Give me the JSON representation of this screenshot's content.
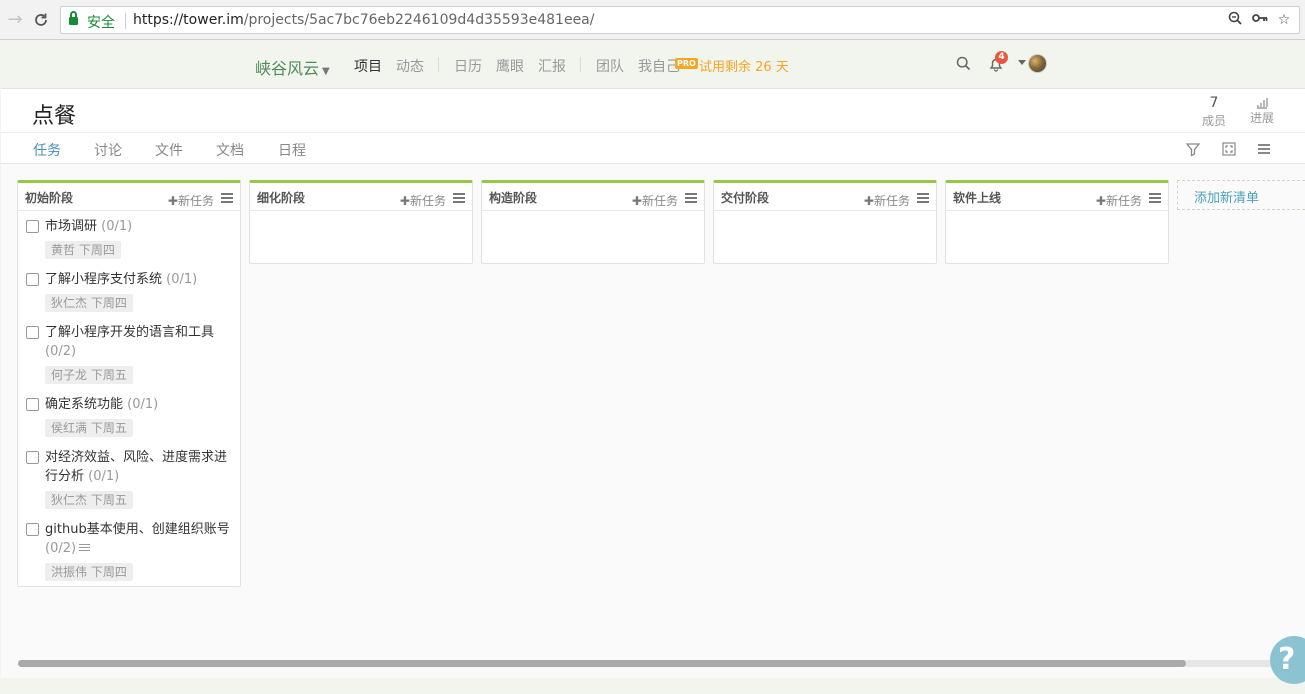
{
  "browser": {
    "secure_label": "安全",
    "url_host": "https://tower.im",
    "url_path": "/projects/5ac7bc76eb2246109d4d35593e481eea/",
    "icons": [
      "back-arrow-icon",
      "reload-icon",
      "lock-icon",
      "zoom-icon",
      "key-icon",
      "star-icon"
    ]
  },
  "header": {
    "team_name": "峡谷风云",
    "nav": [
      "项目",
      "动态",
      "日历",
      "鹰眼",
      "汇报",
      "团队",
      "我自己"
    ],
    "pro_badge": "PRO",
    "trial_text": "试用剩余 26 天",
    "notification_count": "4",
    "accent_color": "#f5a623",
    "badge_color": "#e9573f"
  },
  "project": {
    "title": "点餐",
    "member_count": "7",
    "member_label": "成员",
    "progress_label": "进展",
    "tabs": [
      "任务",
      "讨论",
      "文件",
      "文档",
      "日程"
    ],
    "active_tab": "任务"
  },
  "lists": [
    {
      "name": "初始阶段",
      "new_task": "新任务",
      "tasks": [
        {
          "title": "市场调研",
          "count": "(0/1)",
          "meta": "黄哲 下周四"
        },
        {
          "title": "了解小程序支付系统",
          "count": "(0/1)",
          "meta": "狄仁杰 下周四"
        },
        {
          "title": "了解小程序开发的语言和工具",
          "count": "(0/2)",
          "meta": "何子龙 下周五"
        },
        {
          "title": "确定系统功能",
          "count": "(0/1)",
          "meta": "侯红满 下周五"
        },
        {
          "title": "对经济效益、风险、进度需求进行分析",
          "count": "(0/1)",
          "meta": "狄仁杰 下周五"
        },
        {
          "title": "github基本使用、创建组织账号",
          "count": "(0/2)",
          "meta": "洪振伟 下周四"
        }
      ]
    },
    {
      "name": "细化阶段",
      "new_task": "新任务",
      "tasks": []
    },
    {
      "name": "构造阶段",
      "new_task": "新任务",
      "tasks": []
    },
    {
      "name": "交付阶段",
      "new_task": "新任务",
      "tasks": []
    },
    {
      "name": "软件上线",
      "new_task": "新任务",
      "tasks": []
    }
  ],
  "add_list_label": "添加新清单",
  "help_label": "?",
  "list_accent_color": "#9ac846"
}
